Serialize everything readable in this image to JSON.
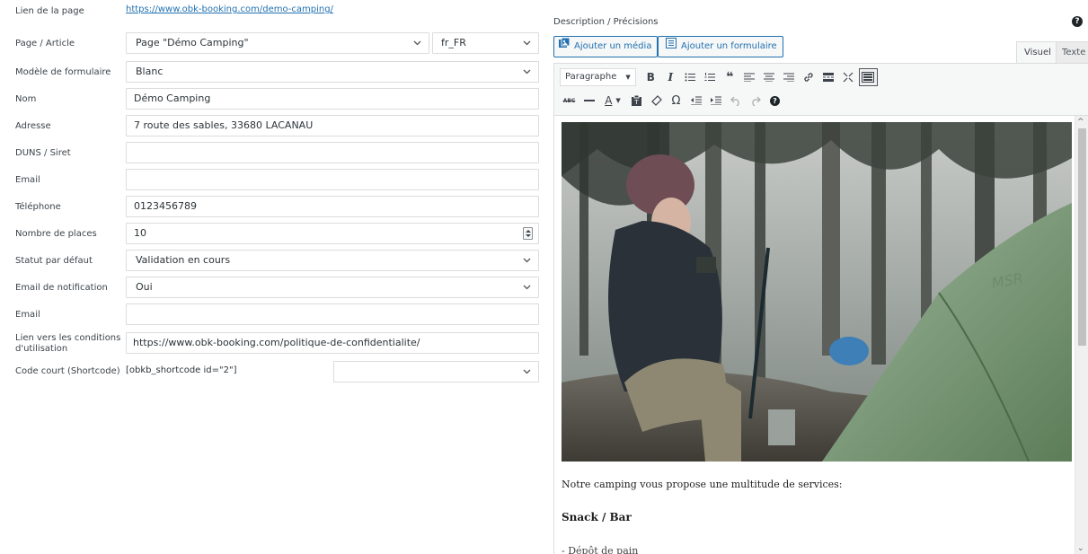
{
  "form": {
    "page_link_label": "Lien de la page",
    "page_link_url": "https://www.obk-booking.com/demo-camping/",
    "page_label": "Page / Article",
    "page_value": "Page \"Démo Camping\"",
    "lang_value": "fr_FR",
    "template_label": "Modèle de formulaire",
    "template_value": "Blanc",
    "name_label": "Nom",
    "name_value": "Démo Camping",
    "address_label": "Adresse",
    "address_value": "7 route des sables, 33680 LACANAU",
    "duns_label": "DUNS / Siret",
    "duns_value": "",
    "email_label": "Email",
    "email_value": "",
    "phone_label": "Téléphone",
    "phone_value": "0123456789",
    "places_label": "Nombre de places",
    "places_value": "10",
    "status_label": "Statut par défaut",
    "status_value": "Validation en cours",
    "notif_label": "Email de notification",
    "notif_value": "Oui",
    "email2_label": "Email",
    "email2_value": "",
    "terms_label_line1": "Lien vers les conditions",
    "terms_label_line2": "d'utilisation",
    "terms_value": "https://www.obk-booking.com/politique-de-confidentialite/",
    "shortcode_label": "Code court (Shortcode)",
    "shortcode_value": "[obkb_shortcode id=\"2\"]",
    "shortcode_select_value": ""
  },
  "editor": {
    "title": "Description / Précisions",
    "help_glyph": "?",
    "add_media_label": "Ajouter un média",
    "add_form_label": "Ajouter un formulaire",
    "tab_visual": "Visuel",
    "tab_text": "Texte",
    "format_select": "Paragraphe",
    "content": {
      "paragraph1": "Notre camping vous propose une multitude de services:",
      "heading": "Snack / Bar",
      "list_item": "- Dépôt de pain"
    }
  },
  "icons": {
    "dropdown": "chevron-down-icon",
    "media": "media-icon",
    "form": "form-icon"
  },
  "colors": {
    "link": "#2271b1",
    "border": "#dcdcde",
    "toolbar_bg": "#f6f7f7"
  }
}
